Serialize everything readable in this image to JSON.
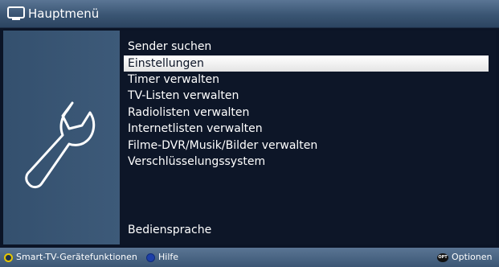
{
  "header": {
    "title": "Hauptmenü",
    "icon": "tv-icon"
  },
  "menu": {
    "items": [
      {
        "label": "Sender suchen",
        "selected": false
      },
      {
        "label": "Einstellungen",
        "selected": true
      },
      {
        "label": "Timer verwalten",
        "selected": false
      },
      {
        "label": "TV-Listen verwalten",
        "selected": false
      },
      {
        "label": "Radiolisten verwalten",
        "selected": false
      },
      {
        "label": "Internetlisten verwalten",
        "selected": false
      },
      {
        "label": "Filme-DVR/Musik/Bilder verwalten",
        "selected": false
      },
      {
        "label": "Verschlüsselungssystem",
        "selected": false
      }
    ],
    "bottom_item": "Bediensprache"
  },
  "sidebar": {
    "icon": "wrench-icon"
  },
  "footer": {
    "yellow_label": "Smart-TV-Gerätefunktionen",
    "blue_label": "Hilfe",
    "opt_icon_text": "OPT",
    "options_label": "Optionen"
  },
  "colors": {
    "header": "#3a5573",
    "left_panel": "#3d5a79",
    "background": "#0d1628",
    "selection": "#ffffff",
    "yellow_button": "#e8c800",
    "blue_button": "#1d3fa8"
  }
}
